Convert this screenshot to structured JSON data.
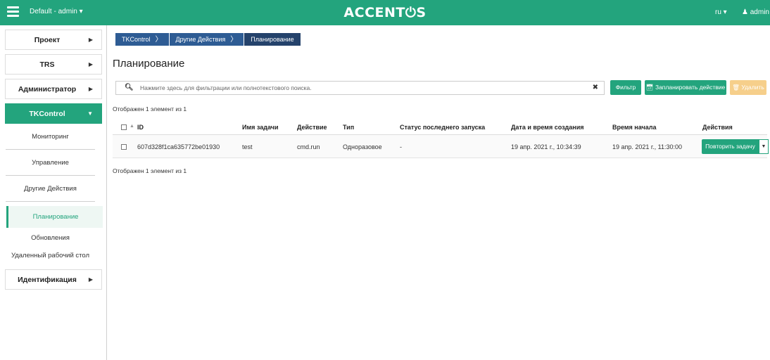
{
  "topbar": {
    "project": "Default - admin ▾",
    "brand": "ACCENT⏻S",
    "lang": "ru ▾",
    "user": "♟ admin ▾"
  },
  "sidebar": {
    "items": [
      {
        "label": "Проект"
      },
      {
        "label": "TRS"
      },
      {
        "label": "Администратор"
      },
      {
        "label": "TKControl"
      }
    ],
    "subitems": [
      {
        "label": "Мониторинг"
      },
      {
        "label": "Управление"
      },
      {
        "label": "Другие Действия"
      },
      {
        "label": "Планирование"
      },
      {
        "label": "Обновления"
      },
      {
        "label": "Удаленный рабочий стол"
      }
    ],
    "identity": {
      "label": "Идентификация"
    }
  },
  "breadcrumb": [
    "TKControl",
    "Другие Действия",
    "Планирование"
  ],
  "page": {
    "title": "Планирование",
    "search_placeholder": "Нажмите здесь для фильтрации или полнотекстового поиска.",
    "filter_label": "Фильтр",
    "schedule_label": "Запланировать действие",
    "delete_label": "Удалить",
    "count_text": "Отображен 1 элемент из 1"
  },
  "table": {
    "headers": {
      "id": "ID",
      "name": "Имя задачи",
      "action": "Действие",
      "type": "Тип",
      "last_status": "Статус последнего запуска",
      "created": "Дата и время создания",
      "start": "Время начала",
      "actions": "Действия"
    },
    "rows": [
      {
        "id": "607d328f1ca635772be01930",
        "name": "test",
        "action": "cmd.run",
        "type": "Одноразовое",
        "last_status": "-",
        "created": "19 апр. 2021 г., 10:34:39",
        "start": "19 апр. 2021 г., 11:30:00",
        "row_action": "Повторить задачу"
      }
    ]
  },
  "colors": {
    "accent": "#23a47d",
    "breadcrumb": "#2e5c94",
    "delete_disabled": "#f6cf8b"
  }
}
